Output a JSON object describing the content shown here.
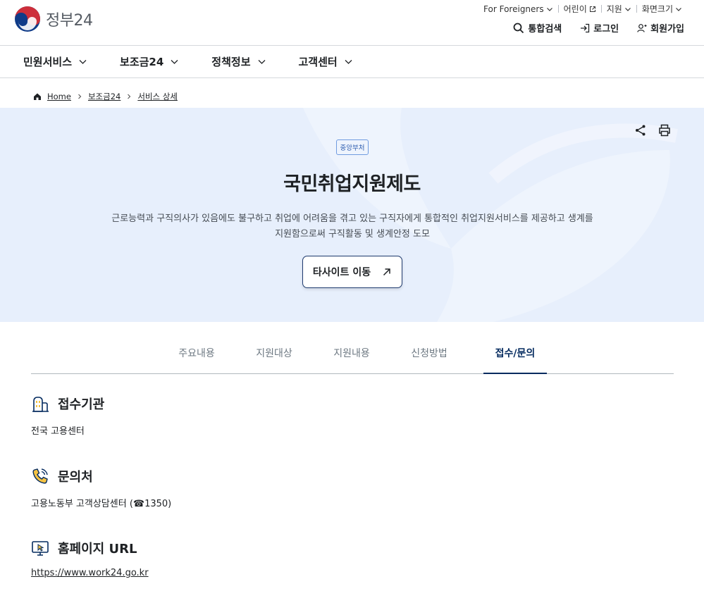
{
  "header": {
    "logo_text": "정부24",
    "util": {
      "foreigners": "For Foreigners",
      "kids": "어린이",
      "support": "지원",
      "screen_size": "화면크기"
    },
    "search": "통합검색",
    "login": "로그인",
    "signup": "회원가입"
  },
  "nav": {
    "items": [
      "민원서비스",
      "보조금24",
      "정책정보",
      "고객센터"
    ]
  },
  "breadcrumb": {
    "home": "Home",
    "level1": "보조금24",
    "level2": "서비스 상세"
  },
  "hero": {
    "badge": "중앙부처",
    "title": "국민취업지원제도",
    "description_line1": "근로능력과 구직의사가 있음에도 불구하고 취업에 어려움을 겪고 있는 구직자에게 통합적인 취업지원서비스를 제공하고 생계를",
    "description_line2": "지원함으로써 구직활동 및 생계안정 도모",
    "site_button": "타사이트 이동"
  },
  "tabs": [
    "주요내용",
    "지원대상",
    "지원내용",
    "신청방법",
    "접수/문의"
  ],
  "sections": {
    "agency": {
      "title": "접수기관",
      "value": "전국 고용센터"
    },
    "contact": {
      "title": "문의처",
      "value": "고용노동부 고객상담센터 (☎1350)"
    },
    "homepage": {
      "title": "홈페이지 URL",
      "value": "https://www.work24.go.kr"
    }
  },
  "colors": {
    "primary": "#052b5f",
    "hero_bg": "#e7effc",
    "logo_red": "#cd2e3a",
    "logo_blue": "#0f3b88",
    "icon_yellow": "#f5c242"
  }
}
